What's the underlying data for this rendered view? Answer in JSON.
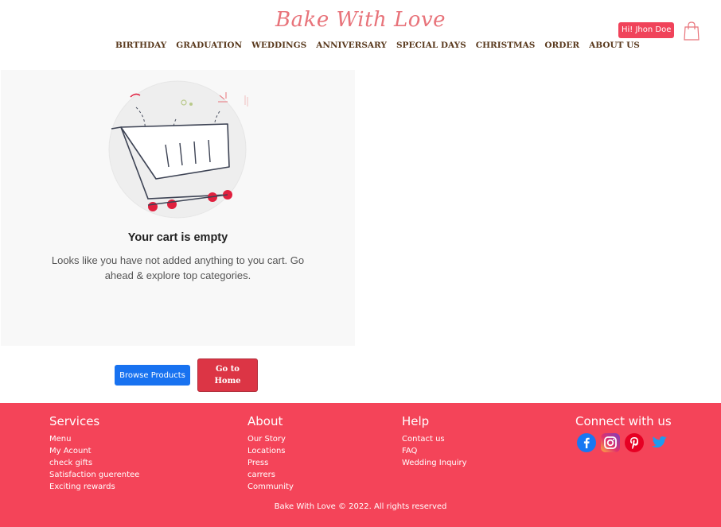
{
  "header": {
    "logo": "Bake With Love",
    "nav": [
      "BIRTHDAY",
      "GRADUATION",
      "WEDDINGS",
      "ANNIVERSARY",
      "SPECIAL DAYS",
      "CHRISTMAS",
      "ORDER",
      "ABOUT US"
    ],
    "user_greeting": "Hi! Jhon Doe"
  },
  "cart": {
    "title": "Your cart is empty",
    "message": "Looks like you have not added anything to you cart. Go ahead & explore top categories."
  },
  "buttons": {
    "browse": "Browse Products",
    "home": "Go to Home"
  },
  "footer": {
    "services": {
      "title": "Services",
      "links": [
        "Menu",
        "My Acount",
        "check gifts",
        "Satisfaction guerentee",
        "Exciting rewards"
      ]
    },
    "about": {
      "title": "About",
      "links": [
        "Our Story",
        "Locations",
        "Press",
        "carrers",
        "Community"
      ]
    },
    "help": {
      "title": "Help",
      "links": [
        "Contact us",
        "FAQ",
        "Wedding Inquiry"
      ]
    },
    "connect": {
      "title": "Connect with us",
      "icons": [
        "facebook-icon",
        "instagram-icon",
        "pinterest-icon",
        "twitter-icon"
      ]
    },
    "copyright": "Bake With Love © 2022. All rights reserved"
  },
  "colors": {
    "brand": "#f44459",
    "logo": "#e8737a",
    "browse": "#1872f0",
    "home": "#dc3545"
  }
}
